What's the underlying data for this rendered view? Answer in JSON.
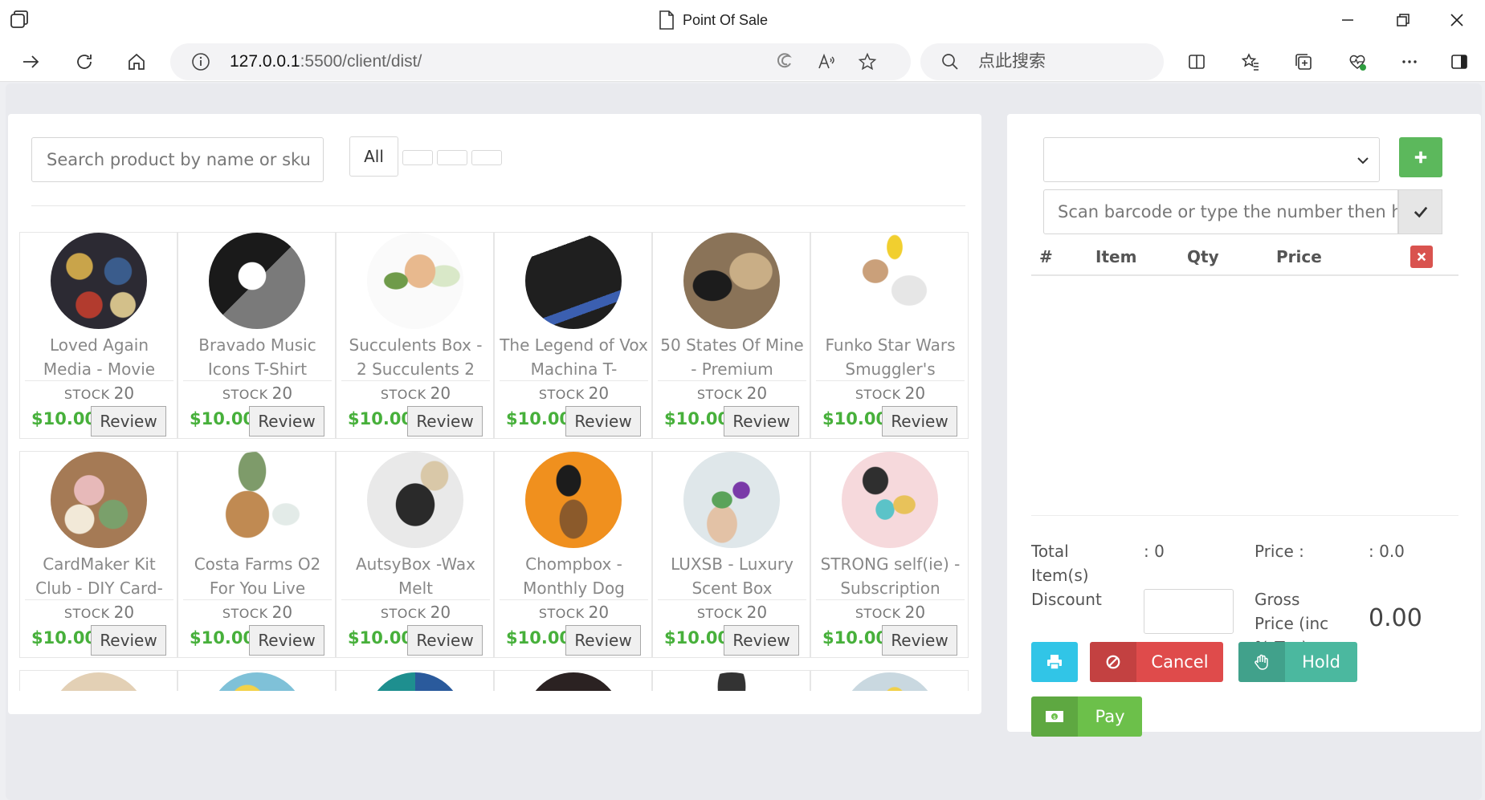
{
  "window": {
    "title": "Point Of Sale"
  },
  "browser": {
    "url_host": "127.0.0.1",
    "url_path": ":5500/client/dist/",
    "search_placeholder": "点此搜索"
  },
  "products": {
    "search_placeholder": "Search product by name or sku",
    "categories": [
      "All",
      "",
      "",
      ""
    ],
    "stock_label": "STOCK",
    "review_label": "Review",
    "items": [
      {
        "name": "Loved Again Media - Movie",
        "stock": "20",
        "price": "$10.00",
        "image": "movies-image"
      },
      {
        "name": "Bravado Music Icons T-Shirt",
        "stock": "20",
        "price": "$10.00",
        "image": "tshirt-image"
      },
      {
        "name": "Succulents Box - 2 Succulents 2",
        "stock": "20",
        "price": "$10.00",
        "image": "succulents-image"
      },
      {
        "name": "The Legend of Vox Machina T-",
        "stock": "20",
        "price": "$10.00",
        "image": "tshirt-black-image"
      },
      {
        "name": "50 States Of Mine - Premium",
        "stock": "20",
        "price": "$10.00",
        "image": "gift-box-image"
      },
      {
        "name": "Funko Star Wars Smuggler's",
        "stock": "20",
        "price": "$10.00",
        "image": "funko-image"
      },
      {
        "name": "CardMaker Kit Club - DIY Card-",
        "stock": "20",
        "price": "$10.00",
        "image": "cardmaker-image"
      },
      {
        "name": "Costa Farms O2 For You Live",
        "stock": "20",
        "price": "$10.00",
        "image": "plant-box-image"
      },
      {
        "name": "AutsyBox -Wax Melt",
        "stock": "20",
        "price": "$10.00",
        "image": "wax-melt-image"
      },
      {
        "name": "Chompbox - Monthly Dog",
        "stock": "20",
        "price": "$10.00",
        "image": "dog-box-image"
      },
      {
        "name": "LUXSB - Luxury Scent Box",
        "stock": "20",
        "price": "$10.00",
        "image": "scent-box-image"
      },
      {
        "name": "STRONG self(ie) - Subscription",
        "stock": "20",
        "price": "$10.00",
        "image": "selfie-box-image"
      }
    ]
  },
  "cart": {
    "barcode_placeholder": "Scan barcode or type the number then hi",
    "columns": [
      "#",
      "Item",
      "Qty",
      "Price"
    ],
    "total_items_label": "Total Item(s)",
    "total_items_value": ": 0",
    "price_label": "Price :",
    "price_value": ": 0.0",
    "discount_label": "Discount",
    "gross_label": "Gross Price (inc % Tax)",
    "gross_value": "0.00",
    "buttons": {
      "cancel": "Cancel",
      "hold": "Hold",
      "pay": "Pay"
    }
  },
  "colors": {
    "price_green": "#47b03b",
    "add_green": "#5cb85c",
    "danger_red": "#df4b4b",
    "print_blue": "#31c5e7",
    "hold_teal": "#4bb89f",
    "pay_green": "#6cc04a"
  }
}
